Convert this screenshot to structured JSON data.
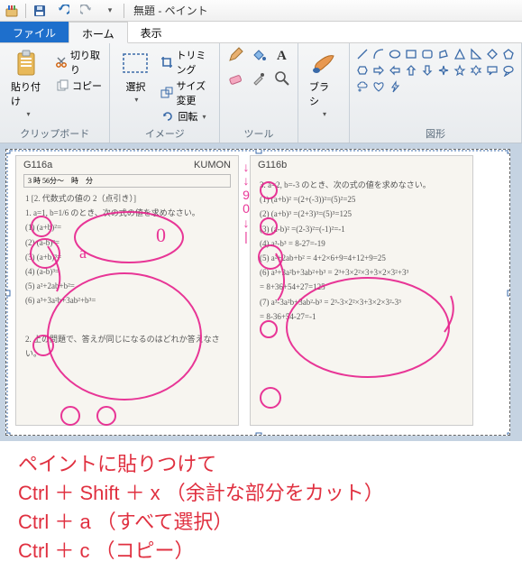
{
  "title": "無題 - ペイント",
  "tabs": {
    "file": "ファイル",
    "home": "ホーム",
    "view": "表示"
  },
  "ribbon": {
    "clipboard": {
      "label": "クリップボード",
      "paste": "貼り付け",
      "cut": "切り取り",
      "copy": "コピー"
    },
    "image": {
      "label": "イメージ",
      "select": "選択",
      "crop": "トリミング",
      "resize": "サイズ変更",
      "rotate": "回転"
    },
    "tools": {
      "label": "ツール"
    },
    "brushes": {
      "label": "ブラシ"
    },
    "shapes": {
      "label": "図形"
    }
  },
  "worksheet": {
    "left_id": "G116a",
    "right_id": "G116b",
    "brand": "KUMON",
    "time_label": "3 時 56分～　時　分",
    "left_prompt": "1 [2. 代数式の値の 2（点引き）]",
    "left_q": "1. a=1, b=1/6 のとき、次の式の値を求めなさい。",
    "left_items": [
      "(1) (a+b)²=",
      "(2) (a-b)²=",
      "(3) (a+b)³=",
      "(4) (a-b)³=",
      "(5) a²+2ab+b²=",
      "(6) a³+3a²b+3ab²+b³="
    ],
    "left_q2": "2. 上の問題で、答えが同じになるのはどれか答えなさい。",
    "right_lead": "3. a=2, b=-3 のとき、次の式の値を求めなさい。",
    "right_items": [
      "(1) (a+b)² =(2+(-3))²=(5)²=25",
      "(2) (a+b)³ =(2+3)³=(5)³=125",
      "(3) (a-b)² =(2-3)²=(-1)²=-1",
      "(4) a³-b³ = 8-27=-19",
      "(5) a²+2ab+b² = 4+2×6+9=4+12+9=25",
      "(6) a³+3a²b+3ab²+b³ = 2³+3×2²×3+3×2×3²+3³",
      "    = 8+36+54+27=125",
      "(7) a³-3a²b+3ab²-b³ = 2³-3×2²×3+3×2×3²-3³",
      "    = 8-36+54-27=-1"
    ]
  },
  "caption": {
    "l1": "ペイントに貼りつけて",
    "l2": "Ctrl ＋ Shift ＋ x （余計な部分をカット）",
    "l3": "Ctrl ＋ a （すべて選択）",
    "l4": "Ctrl ＋ c （コピー）"
  }
}
